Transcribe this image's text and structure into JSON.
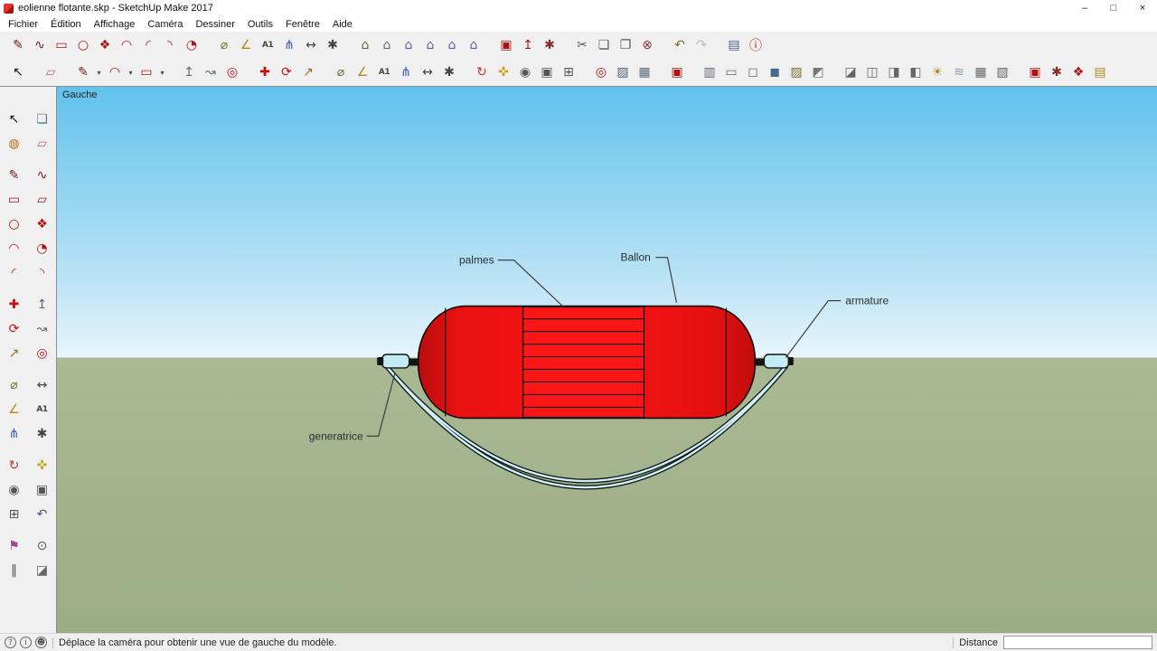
{
  "titlebar": {
    "title": "eolienne flotante.skp - SketchUp Make 2017",
    "minimize_glyph": "–",
    "maximize_glyph": "□",
    "close_glyph": "×"
  },
  "menubar": {
    "items": [
      {
        "name": "menu-fichier",
        "label": "Fichier"
      },
      {
        "name": "menu-edition",
        "label": "Édition"
      },
      {
        "name": "menu-affichage",
        "label": "Affichage"
      },
      {
        "name": "menu-camera",
        "label": "Caméra"
      },
      {
        "name": "menu-dessiner",
        "label": "Dessiner"
      },
      {
        "name": "menu-outils",
        "label": "Outils"
      },
      {
        "name": "menu-fenetre",
        "label": "Fenêtre"
      },
      {
        "name": "menu-aide",
        "label": "Aide"
      }
    ]
  },
  "toolbar_row1": {
    "draw": [
      {
        "name": "line-tool-icon",
        "glyph": "✎",
        "color": "#7a1515"
      },
      {
        "name": "freehand-tool-icon",
        "glyph": "∿",
        "color": "#7a1515"
      },
      {
        "name": "rectangle-tool-icon",
        "glyph": "▭",
        "color": "#b01212"
      },
      {
        "name": "circle-tool-icon",
        "glyph": "○",
        "color": "#b01212"
      },
      {
        "name": "polygon-tool-icon",
        "glyph": "❖",
        "color": "#b01212"
      },
      {
        "name": "arc-tool-icon",
        "glyph": "◠",
        "color": "#b01212"
      },
      {
        "name": "two-point-arc-tool-icon",
        "glyph": "◜",
        "color": "#b01212"
      },
      {
        "name": "three-point-arc-tool-icon",
        "glyph": "◝",
        "color": "#b01212"
      },
      {
        "name": "pie-tool-icon",
        "glyph": "◔",
        "color": "#b01212"
      }
    ],
    "construction": [
      {
        "name": "tape-measure-icon",
        "glyph": "⌀",
        "color": "#70702a"
      },
      {
        "name": "protractor-icon",
        "glyph": "∠",
        "color": "#b08a1a"
      },
      {
        "name": "text-tool-icon",
        "glyph": "A1",
        "color": "#444444",
        "cls": "tb-icon txt"
      },
      {
        "name": "axes-tool-icon",
        "glyph": "⋔",
        "color": "#3355bb"
      },
      {
        "name": "dimensions-tool-icon",
        "glyph": "↔",
        "color": "#444444"
      },
      {
        "name": "3d-text-tool-icon",
        "glyph": "✱",
        "color": "#444444"
      }
    ],
    "views": [
      {
        "name": "view-iso-icon",
        "glyph": "⌂",
        "color": "#7a5a2a"
      },
      {
        "name": "view-top-icon",
        "glyph": "⌂",
        "color": "#666666"
      },
      {
        "name": "view-front-icon",
        "glyph": "⌂",
        "color": "#4a6a9a"
      },
      {
        "name": "view-right-icon",
        "glyph": "⌂",
        "color": "#4a6a9a"
      },
      {
        "name": "view-left-icon",
        "glyph": "⌂",
        "color": "#4a6a9a"
      },
      {
        "name": "view-back-icon",
        "glyph": "⌂",
        "color": "#4a6a9a"
      }
    ],
    "warehouse": [
      {
        "name": "get-models-icon",
        "glyph": "▣",
        "color": "#b01212"
      },
      {
        "name": "share-model-icon",
        "glyph": "↥",
        "color": "#b01212"
      },
      {
        "name": "extension-warehouse-icon",
        "glyph": "✱",
        "color": "#8a2a2a"
      }
    ],
    "clipboard": [
      {
        "name": "cut-icon",
        "glyph": "✂",
        "color": "#555555"
      },
      {
        "name": "copy-icon",
        "glyph": "❏",
        "color": "#555555"
      },
      {
        "name": "paste-icon",
        "glyph": "❐",
        "color": "#555555"
      },
      {
        "name": "erase-icon",
        "glyph": "⊗",
        "color": "#8a3a3a"
      }
    ],
    "history": [
      {
        "name": "undo-icon",
        "glyph": "↶",
        "color": "#8a6a1a"
      },
      {
        "name": "redo-icon",
        "glyph": "↷",
        "color": "#bbbbbb"
      }
    ],
    "panels": [
      {
        "name": "styles-panel-icon",
        "glyph": "▤",
        "color": "#4a5a8a"
      },
      {
        "name": "model-info-icon",
        "glyph": "ⓘ",
        "color": "#b01212"
      }
    ]
  },
  "toolbar_row2": {
    "select": [
      {
        "name": "select-tool-icon",
        "glyph": "↖",
        "color": "#111111"
      }
    ],
    "eraser": [
      {
        "name": "eraser-tool-icon",
        "glyph": "▱",
        "color": "#c06080"
      }
    ],
    "draw": [
      {
        "name": "line-tool-icon",
        "glyph": "✎",
        "color": "#7a1515"
      },
      {
        "name": "line-dropdown-caret-icon",
        "glyph": "▾",
        "color": "#444444",
        "cls": "tb-icon sm"
      },
      {
        "name": "arc-tool-icon",
        "glyph": "◠",
        "color": "#b01212"
      },
      {
        "name": "arc-dropdown-caret-icon",
        "glyph": "▾",
        "color": "#444444",
        "cls": "tb-icon sm"
      },
      {
        "name": "shapes-tool-icon",
        "glyph": "▭",
        "color": "#b01212"
      },
      {
        "name": "shapes-dropdown-caret-icon",
        "glyph": "▾",
        "color": "#444444",
        "cls": "tb-icon sm"
      }
    ],
    "edit": [
      {
        "name": "push-pull-tool-icon",
        "glyph": "↥",
        "color": "#5a6a7a"
      },
      {
        "name": "follow-me-tool-icon",
        "glyph": "↝",
        "color": "#666666"
      },
      {
        "name": "offset-tool-icon",
        "glyph": "◎",
        "color": "#b01212"
      }
    ],
    "transform": [
      {
        "name": "move-tool-icon",
        "glyph": "✚",
        "color": "#c01010"
      },
      {
        "name": "rotate-tool-icon",
        "glyph": "⟳",
        "color": "#c01010"
      },
      {
        "name": "scale-tool-icon",
        "glyph": "↗",
        "color": "#9a6a2a"
      }
    ],
    "construction": [
      {
        "name": "tape-measure-icon",
        "glyph": "⌀",
        "color": "#70702a"
      },
      {
        "name": "protractor-icon",
        "glyph": "∠",
        "color": "#b08a1a"
      },
      {
        "name": "text-tool-icon",
        "glyph": "A1",
        "color": "#444444",
        "cls": "tb-icon txt"
      },
      {
        "name": "axes-tool-icon",
        "glyph": "⋔",
        "color": "#3355bb"
      },
      {
        "name": "dimensions-tool-icon",
        "glyph": "↔",
        "color": "#444444"
      },
      {
        "name": "3d-text-tool-icon",
        "glyph": "✱",
        "color": "#444444"
      }
    ],
    "camera": [
      {
        "name": "orbit-tool-icon",
        "glyph": "↻",
        "color": "#c03030"
      },
      {
        "name": "pan-tool-icon",
        "glyph": "✜",
        "color": "#c8a21a"
      },
      {
        "name": "zoom-tool-icon",
        "glyph": "◉",
        "color": "#555555"
      },
      {
        "name": "zoom-window-tool-icon",
        "glyph": "▣",
        "color": "#555555"
      },
      {
        "name": "zoom-extents-tool-icon",
        "glyph": "⊞",
        "color": "#555555"
      }
    ],
    "location": [
      {
        "name": "add-location-icon",
        "glyph": "◎",
        "color": "#b01212"
      },
      {
        "name": "toggle-terrain-icon",
        "glyph": "▨",
        "color": "#556677"
      },
      {
        "name": "photo-textures-icon",
        "glyph": "▦",
        "color": "#556677"
      }
    ],
    "warehouse": [
      {
        "name": "3d-warehouse-icon",
        "glyph": "▣",
        "color": "#b01212"
      }
    ],
    "styles": [
      {
        "name": "x-ray-style-icon",
        "glyph": "▥",
        "color": "#666677"
      },
      {
        "name": "wireframe-style-icon",
        "glyph": "▭",
        "color": "#666677"
      },
      {
        "name": "hidden-line-style-icon",
        "glyph": "◻",
        "color": "#666677"
      },
      {
        "name": "shaded-style-icon",
        "glyph": "◼",
        "color": "#476a8a"
      },
      {
        "name": "shaded-textured-style-icon",
        "glyph": "▨",
        "color": "#8a6a3a"
      },
      {
        "name": "monochrome-style-icon",
        "glyph": "◩",
        "color": "#777777"
      }
    ],
    "sections": [
      {
        "name": "section-plane-icon",
        "glyph": "◪",
        "color": "#666666"
      },
      {
        "name": "display-section-planes-icon",
        "glyph": "◫",
        "color": "#666666"
      },
      {
        "name": "display-section-cuts-icon",
        "glyph": "◨",
        "color": "#666666"
      },
      {
        "name": "display-section-fill-icon",
        "glyph": "◧",
        "color": "#666666"
      },
      {
        "name": "shadows-icon",
        "glyph": "☀",
        "color": "#b08a1a"
      },
      {
        "name": "fog-icon",
        "glyph": "≋",
        "color": "#88a0b0"
      },
      {
        "name": "match-photo-icon",
        "glyph": "▦",
        "color": "#666666"
      },
      {
        "name": "edit-matched-photo-icon",
        "glyph": "▧",
        "color": "#666666"
      }
    ],
    "extras": [
      {
        "name": "get-models-icon",
        "glyph": "▣",
        "color": "#b01212"
      },
      {
        "name": "extension-warehouse-icon",
        "glyph": "✱",
        "color": "#8a2a2a"
      },
      {
        "name": "extension-manager-icon",
        "glyph": "❖",
        "color": "#b01212"
      },
      {
        "name": "preferences-icon",
        "glyph": "▤",
        "color": "#b08a1a"
      }
    ]
  },
  "left_toolbar": {
    "principal": [
      {
        "name": "select-tool-icon",
        "glyph": "↖",
        "color": "#111111"
      },
      {
        "name": "make-component-icon",
        "glyph": "❏",
        "color": "#5a7a8a"
      },
      {
        "name": "paint-bucket-icon",
        "glyph": "◍",
        "color": "#c06a1a"
      },
      {
        "name": "eraser-tool-icon",
        "glyph": "▱",
        "color": "#c06080"
      }
    ],
    "draw": [
      {
        "name": "line-tool-icon",
        "glyph": "✎",
        "color": "#7a1515"
      },
      {
        "name": "freehand-tool-icon",
        "glyph": "∿",
        "color": "#7a1515"
      },
      {
        "name": "rectangle-tool-icon",
        "glyph": "▭",
        "color": "#b01212"
      },
      {
        "name": "rotated-rectangle-tool-icon",
        "glyph": "▱",
        "color": "#b01212"
      },
      {
        "name": "circle-tool-icon",
        "glyph": "○",
        "color": "#b01212"
      },
      {
        "name": "polygon-tool-icon",
        "glyph": "❖",
        "color": "#b01212"
      },
      {
        "name": "arc-tool-icon",
        "glyph": "◠",
        "color": "#b01212"
      },
      {
        "name": "pie-tool-icon",
        "glyph": "◔",
        "color": "#b01212"
      },
      {
        "name": "two-point-arc-tool-icon",
        "glyph": "◜",
        "color": "#b01212"
      },
      {
        "name": "three-point-arc-tool-icon",
        "glyph": "◝",
        "color": "#b01212"
      }
    ],
    "edit": [
      {
        "name": "move-tool-icon",
        "glyph": "✚",
        "color": "#c01010"
      },
      {
        "name": "push-pull-tool-icon",
        "glyph": "↥",
        "color": "#5a6a7a"
      },
      {
        "name": "rotate-tool-icon",
        "glyph": "⟳",
        "color": "#c01010"
      },
      {
        "name": "follow-me-tool-icon",
        "glyph": "↝",
        "color": "#666666"
      },
      {
        "name": "scale-tool-icon",
        "glyph": "↗",
        "color": "#9a6a2a"
      },
      {
        "name": "offset-tool-icon",
        "glyph": "◎",
        "color": "#b01212"
      }
    ],
    "construction": [
      {
        "name": "tape-measure-icon",
        "glyph": "⌀",
        "color": "#70702a"
      },
      {
        "name": "dimensions-tool-icon",
        "glyph": "↔",
        "color": "#444444"
      },
      {
        "name": "protractor-icon",
        "glyph": "∠",
        "color": "#b08a1a"
      },
      {
        "name": "text-tool-icon",
        "glyph": "A1",
        "color": "#444444",
        "cls": "tb-icon txt"
      },
      {
        "name": "axes-tool-icon",
        "glyph": "⋔",
        "color": "#3355bb"
      },
      {
        "name": "3d-text-tool-icon",
        "glyph": "✱",
        "color": "#444444"
      }
    ],
    "camera": [
      {
        "name": "orbit-tool-icon",
        "glyph": "↻",
        "color": "#c03030"
      },
      {
        "name": "pan-tool-icon",
        "glyph": "✜",
        "color": "#c8a21a"
      },
      {
        "name": "zoom-tool-icon",
        "glyph": "◉",
        "color": "#555555"
      },
      {
        "name": "zoom-window-tool-icon",
        "glyph": "▣",
        "color": "#555555"
      },
      {
        "name": "zoom-extents-tool-icon",
        "glyph": "⊞",
        "color": "#555555"
      },
      {
        "name": "previous-view-icon",
        "glyph": "↶",
        "color": "#555577"
      }
    ],
    "walkthrough": [
      {
        "name": "position-camera-icon",
        "glyph": "⚑",
        "color": "#a04a8a"
      },
      {
        "name": "look-around-icon",
        "glyph": "⊙",
        "color": "#555555"
      },
      {
        "name": "walk-tool-icon",
        "glyph": "‖",
        "color": "#555555"
      },
      {
        "name": "section-plane-icon",
        "glyph": "◪",
        "color": "#666666"
      }
    ]
  },
  "viewport": {
    "view_label": "Gauche",
    "annotations": {
      "palmes": "palmes",
      "ballon": "Ballon",
      "armature": "armature",
      "generatrice": "generatrice"
    },
    "colors": {
      "sky_top": "#62c2ee",
      "sky_horizon": "#e9f5fb",
      "ground": "#a2b28c",
      "balloon": "#ea0c0c",
      "balloon_bright": "#fb1616",
      "rope": "#d2eff6",
      "connector": "#c4ecf4"
    }
  },
  "statusbar": {
    "icons": [
      {
        "name": "help-icon",
        "glyph": "?"
      },
      {
        "name": "info-icon",
        "glyph": "i"
      },
      {
        "name": "account-icon",
        "glyph": "☻"
      }
    ],
    "help_text": "Déplace la caméra pour obtenir une vue de gauche du modèle.",
    "measure_label": "Distance",
    "measure_value": ""
  }
}
